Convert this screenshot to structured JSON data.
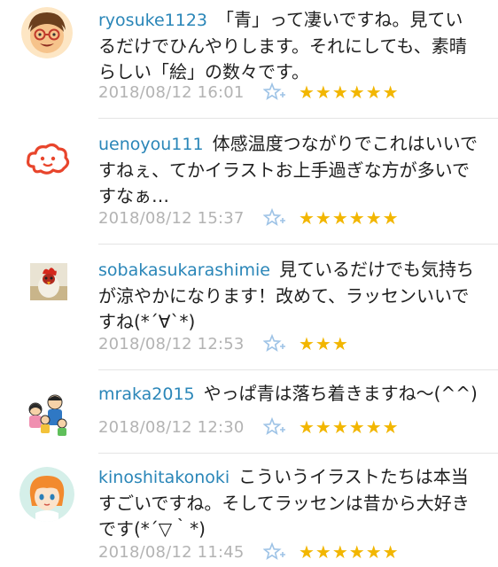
{
  "comments": [
    {
      "user": "ryosuke1123",
      "text": "「青」って凄いですね。見ているだけでひんやりします。それにしても、素晴らしい「絵」の数々です。",
      "time": "2018/08/12 16:01",
      "stars": "★★★★★★",
      "avatar_icon": "smiling-man-glasses-icon"
    },
    {
      "user": "uenoyou111",
      "text": "体感温度つながりでこれはいいですねぇ、てかイラストお上手過ぎな方が多いですなぁ…",
      "time": "2018/08/12 15:37",
      "stars": "★★★★★★",
      "avatar_icon": "cloud-face-icon"
    },
    {
      "user": "sobakasukarashimie",
      "text": "見ているだけでも気持ちが涼やかになります！改めて、ラッセンいいですね(*´∀`*)",
      "time": "2018/08/12 12:53",
      "stars": "★★★",
      "avatar_icon": "chicken-photo-icon"
    },
    {
      "user": "mraka2015",
      "text": "やっぱ青は落ち着きますね〜(^^)",
      "time": "2018/08/12 12:30",
      "stars": "★★★★★★",
      "avatar_icon": "family-illustration-icon"
    },
    {
      "user": "kinoshitakonoki",
      "text": "こういうイラストたちは本当すごいですね。そしてラッセンは昔から大好きです(*´▽｀*)",
      "time": "2018/08/12 11:45",
      "stars": "★★★★★★",
      "avatar_icon": "orange-hair-girl-icon"
    }
  ],
  "colors": {
    "username": "#2a86b8",
    "star": "#f2b600",
    "timestamp": "#b3b3b3",
    "favorite_icon": "#9ec3e6"
  }
}
